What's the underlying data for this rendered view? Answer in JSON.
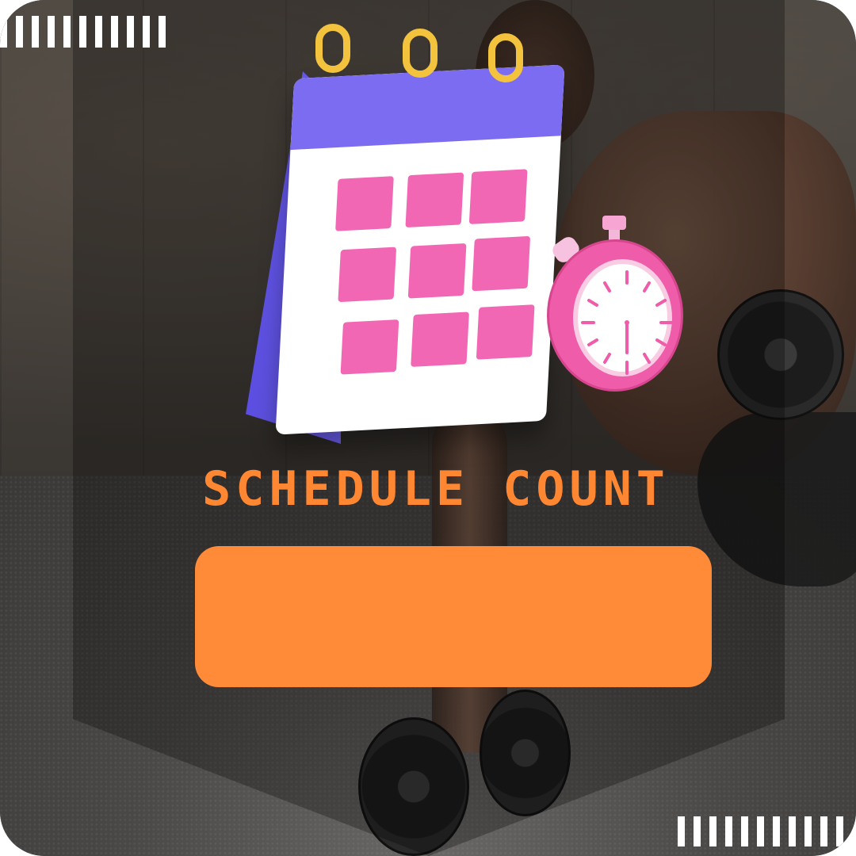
{
  "title": "SCHEDULE COUNT",
  "count_value": "",
  "icons": {
    "calendar": "calendar-icon",
    "stopwatch": "stopwatch-icon",
    "dumbbell": "dumbbell-icon"
  },
  "colors": {
    "accent_orange": "#ff8a37",
    "title_orange": "#ff8732",
    "calendar_purple": "#7b6cf2",
    "calendar_pink": "#f267b4",
    "ring_yellow": "#f3c33e",
    "stopwatch_pink": "#ef5ca9"
  }
}
